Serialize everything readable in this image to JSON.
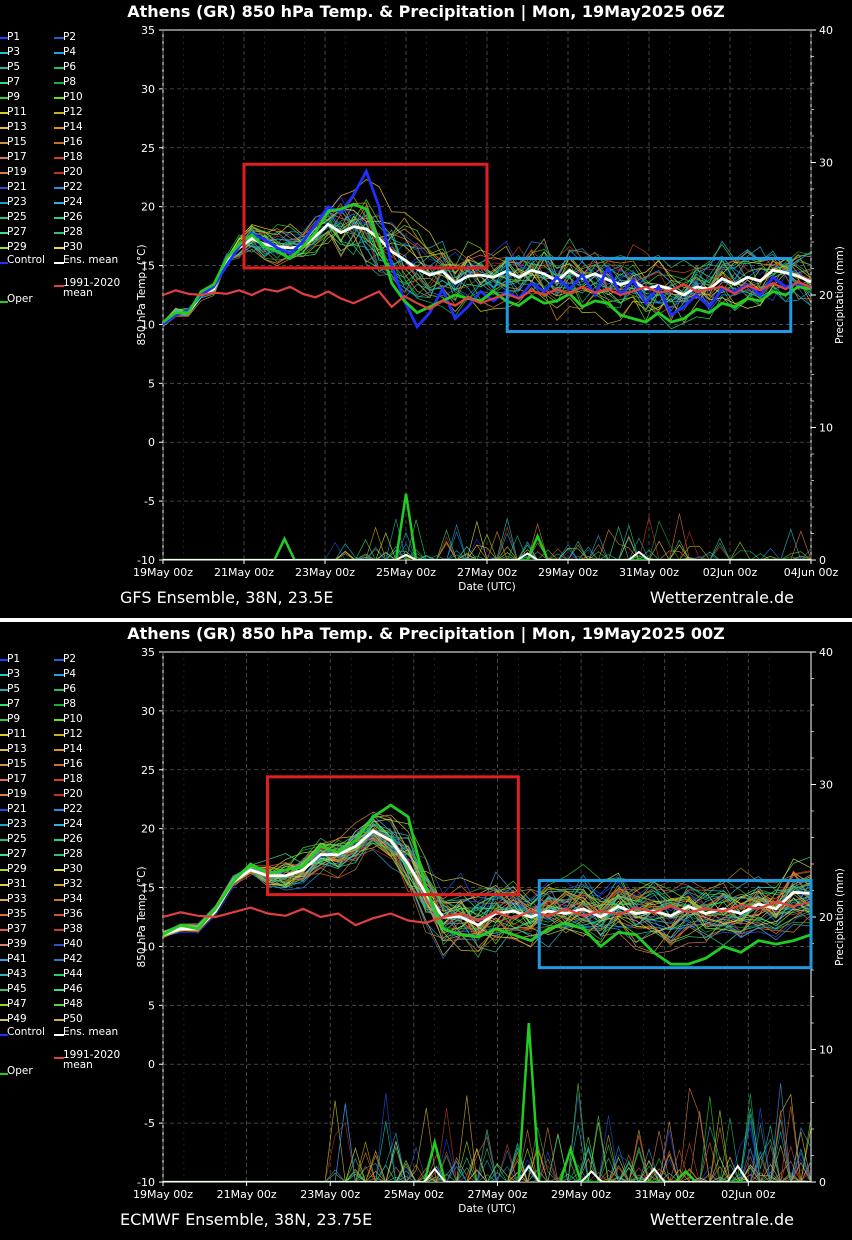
{
  "panels": [
    {
      "title": "Athens  (GR)  850 hPa Temp. & Precipitation | Mon, 19May2025 06Z",
      "model_label": "GFS Ensemble, 38N, 23.5E",
      "brand": "Wetterzentrale.de",
      "legend": {
        "members": [
          "P1",
          "P2",
          "P3",
          "P4",
          "P5",
          "P6",
          "P7",
          "P8",
          "P9",
          "P10",
          "P11",
          "P12",
          "P13",
          "P14",
          "P15",
          "P16",
          "P17",
          "P18",
          "P19",
          "P20",
          "P21",
          "P22",
          "P23",
          "P24",
          "P25",
          "P26",
          "P27",
          "P28",
          "P29",
          "P30"
        ],
        "control": "Control",
        "ens_mean": "Ens. mean",
        "oper": "Oper",
        "climate": "1991-2020\nmean"
      },
      "chart_data": {
        "type": "line",
        "ylabel": "850 hPa Temp. (°C)",
        "y2label": "Precipitation (mm)",
        "ylim": [
          -10,
          35
        ],
        "y2lim": [
          0,
          40
        ],
        "xlim": [
          "19May 00z",
          "04Jun 00z"
        ],
        "x_ticks": [
          "19May 00z",
          "21May 00z",
          "23May 00z",
          "25May 00z",
          "27May 00z",
          "29May 00z",
          "31May 00z",
          "02Jun 00z",
          "04Jun 00z"
        ],
        "y_ticks": [
          -10,
          -5,
          0,
          5,
          10,
          15,
          20,
          25,
          30,
          35
        ],
        "y2_ticks": [
          0,
          10,
          20,
          30,
          40
        ],
        "grid": true,
        "x_hours": [
          6,
          12,
          18,
          24,
          30,
          36,
          42,
          48,
          54,
          60,
          66,
          72,
          78,
          84,
          90,
          96,
          102,
          108,
          114,
          120,
          126,
          132,
          138,
          144,
          150,
          156,
          162,
          168,
          174,
          180,
          186,
          192,
          198,
          204,
          210,
          216,
          222,
          228,
          234,
          240,
          246,
          252,
          258,
          264,
          270,
          276,
          282,
          288,
          294,
          300,
          306,
          312,
          318,
          324,
          330,
          336,
          342,
          348,
          354,
          360,
          366,
          372,
          378,
          384
        ],
        "series": [
          {
            "name": "Ens. mean",
            "color": "#ffffff",
            "values": [
              10.0,
              11.0,
              11.0,
              12.5,
              13.0,
              15.5,
              16.5,
              17.3,
              16.8,
              16.6,
              16.5,
              16.6,
              17.5,
              18.5,
              17.8,
              18.3,
              18.1,
              17.3,
              16.2,
              15.5,
              14.7,
              14.2,
              14.5,
              13.5,
              14.1,
              14.2,
              14.0,
              14.5,
              14.0,
              14.6,
              14.3,
              13.7,
              14.6,
              13.9,
              14.3,
              13.8,
              13.4,
              13.7,
              13.0,
              13.3,
              13.0,
              12.5,
              13.2,
              13.0,
              13.9,
              13.4,
              14.0,
              13.7,
              14.6,
              14.4,
              14.1,
              13.6
            ]
          },
          {
            "name": "Control",
            "color": "#1f2fff",
            "values": [
              10.0,
              10.8,
              11.2,
              12.5,
              13.2,
              15.0,
              16.6,
              17.7,
              17.2,
              16.5,
              16.0,
              17.0,
              18.5,
              20.0,
              19.5,
              21.0,
              23.0,
              20.0,
              15.0,
              12.0,
              9.8,
              11.0,
              13.0,
              10.5,
              11.5,
              12.8,
              12.0,
              12.8,
              12.2,
              13.5,
              12.8,
              14.0,
              13.0,
              14.2,
              12.5,
              14.8,
              12.5,
              13.8,
              11.8,
              13.2,
              10.8,
              11.5,
              12.5,
              11.5,
              13.0,
              12.8,
              13.4,
              12.5,
              14.0,
              13.2,
              13.5,
              13.0
            ]
          },
          {
            "name": "Oper",
            "color": "#22cc22",
            "values": [
              10.2,
              11.0,
              11.0,
              12.8,
              13.4,
              15.6,
              16.8,
              17.6,
              16.6,
              16.2,
              15.6,
              16.6,
              17.8,
              19.6,
              19.8,
              20.2,
              19.8,
              17.0,
              13.5,
              12.0,
              11.0,
              11.5,
              12.0,
              12.5,
              12.2,
              12.0,
              12.8,
              12.0,
              11.6,
              12.4,
              11.8,
              12.0,
              12.6,
              11.5,
              12.0,
              11.8,
              10.8,
              10.5,
              10.2,
              11.0,
              10.2,
              10.5,
              11.3,
              11.0,
              11.8,
              11.5,
              12.2,
              12.0,
              12.8,
              12.5,
              13.2,
              13.0
            ]
          },
          {
            "name": "1991-2020 mean",
            "color": "#e04040",
            "values": [
              12.5,
              12.9,
              12.6,
              12.5,
              12.7,
              12.6,
              12.9,
              12.5,
              13.0,
              12.8,
              13.2,
              12.6,
              12.3,
              12.8,
              12.2,
              11.8,
              12.3,
              12.8,
              11.5,
              12.4,
              11.8,
              11.3,
              12.0,
              11.6,
              12.3,
              11.8,
              12.2,
              12.6,
              12.2,
              12.9,
              12.5,
              13.0,
              12.6,
              13.2,
              12.7,
              13.0,
              12.5,
              12.8,
              13.2,
              12.7,
              12.9,
              13.4,
              12.8,
              13.0,
              13.2,
              12.6,
              13.3,
              12.9,
              13.5,
              13.0,
              13.6,
              13.1
            ]
          }
        ],
        "precip_series": [
          {
            "name": "Oper",
            "color": "#22cc22",
            "values": [
              0,
              0,
              0,
              0,
              0,
              0,
              0,
              0,
              0,
              0,
              0,
              0,
              0,
              0,
              0,
              0,
              0,
              0,
              0,
              0,
              1.5,
              0,
              0,
              0,
              0,
              0,
              0,
              0,
              0,
              0,
              0,
              0,
              0,
              0,
              0,
              0,
              0,
              0,
              0,
              0,
              0,
              0,
              0,
              0,
              0,
              0,
              0,
              0,
              0,
              0,
              0,
              0,
              0,
              0,
              0,
              0,
              0,
              0,
              0,
              0,
              0,
              0,
              0,
              0,
              0
            ],
            "peaks": [
              [
                72,
                1.6
              ],
              [
                144,
                5.0
              ],
              [
                222,
                1.8
              ]
            ]
          },
          {
            "name": "Ens. mean",
            "color": "#ffffff",
            "values": [],
            "peaks": [
              [
                144,
                0.4
              ],
              [
                216,
                0.5
              ],
              [
                282,
                0.6
              ]
            ]
          }
        ]
      },
      "boxes": [
        {
          "name": "red",
          "color": "#e02020",
          "x_range": [
            "21May 00z",
            "27May 00z"
          ],
          "y_range": [
            14.8,
            23.6
          ]
        },
        {
          "name": "blue",
          "color": "#1e9be0",
          "x_range": [
            "27May 12z",
            "03Jun 12z"
          ],
          "y_range": [
            9.4,
            15.6
          ]
        }
      ]
    },
    {
      "title": "Athens  (GR)  850 hPa Temp. & Precipitation | Mon, 19May2025 00Z",
      "model_label": "ECMWF Ensemble, 38N, 23.75E",
      "brand": "Wetterzentrale.de",
      "legend": {
        "members": [
          "P1",
          "P2",
          "P3",
          "P4",
          "P5",
          "P6",
          "P7",
          "P8",
          "P9",
          "P10",
          "P11",
          "P12",
          "P13",
          "P14",
          "P15",
          "P16",
          "P17",
          "P18",
          "P19",
          "P20",
          "P21",
          "P22",
          "P23",
          "P24",
          "P25",
          "P26",
          "P27",
          "P28",
          "P29",
          "P30",
          "P31",
          "P32",
          "P33",
          "P34",
          "P35",
          "P36",
          "P37",
          "P38",
          "P39",
          "P40",
          "P41",
          "P42",
          "P43",
          "P44",
          "P45",
          "P46",
          "P47",
          "P48",
          "P49",
          "P50"
        ],
        "control": "Control",
        "ens_mean": "Ens. mean",
        "oper": "Oper",
        "climate": "1991-2020\nmean"
      },
      "chart_data": {
        "type": "line",
        "ylabel": "850 hPa Temp. (°C)",
        "y2label": "Precipitation (mm)",
        "ylim": [
          -10,
          35
        ],
        "y2lim": [
          0,
          40
        ],
        "xlim": [
          "19May 00z",
          "03Jun 12z"
        ],
        "x_ticks": [
          "19May 00z",
          "21May 00z",
          "23May 00z",
          "25May 00z",
          "27May 00z",
          "29May 00z",
          "31May 00z",
          "02Jun 00z"
        ],
        "y_ticks": [
          -10,
          -5,
          0,
          5,
          10,
          15,
          20,
          25,
          30,
          35
        ],
        "y2_ticks": [
          0,
          10,
          20,
          30,
          40
        ],
        "grid": true,
        "series": [
          {
            "name": "Ens. mean",
            "color": "#ffffff",
            "values": [
              11.0,
              11.5,
              11.5,
              13.0,
              15.5,
              16.5,
              16.0,
              16.0,
              16.5,
              17.8,
              17.8,
              18.5,
              19.8,
              19.0,
              17.0,
              14.5,
              12.5,
              12.5,
              11.8,
              12.8,
              13.0,
              12.5,
              13.0,
              12.8,
              13.2,
              12.5,
              13.4,
              12.8,
              13.0,
              12.6,
              13.4,
              12.8,
              13.2,
              12.8,
              13.6,
              13.2,
              14.6,
              14.5
            ]
          },
          {
            "name": "Oper",
            "color": "#22cc22",
            "values": [
              11.0,
              11.8,
              11.5,
              13.2,
              15.5,
              17.0,
              16.2,
              16.5,
              16.8,
              18.5,
              18.0,
              19.0,
              21.0,
              22.0,
              21.0,
              15.0,
              11.5,
              11.0,
              10.8,
              11.5,
              11.0,
              10.5,
              11.5,
              12.0,
              11.5,
              10.0,
              11.2,
              11.0,
              9.5,
              8.5,
              8.5,
              9.0,
              10.0,
              9.5,
              10.5,
              10.2,
              10.5,
              11.0
            ]
          },
          {
            "name": "1991-2020 mean",
            "color": "#e04040",
            "values": [
              12.5,
              12.9,
              12.6,
              12.5,
              12.9,
              13.3,
              12.8,
              12.6,
              13.2,
              12.5,
              12.8,
              11.8,
              12.4,
              12.8,
              12.2,
              12.0,
              12.5,
              12.8,
              12.2,
              12.9,
              12.4,
              13.0,
              12.6,
              13.2,
              12.6,
              13.0,
              12.7,
              13.3,
              12.9,
              13.4,
              12.9,
              13.2,
              13.0,
              13.5,
              13.2,
              13.8,
              13.4,
              13.8
            ]
          }
        ],
        "precip_series": [
          {
            "name": "Oper",
            "color": "#22cc22",
            "values": [],
            "peaks": [
              [
                156,
                3.0
              ],
              [
                210,
                12.0
              ],
              [
                234,
                2.5
              ],
              [
                300,
                0.8
              ]
            ]
          },
          {
            "name": "Ens. mean",
            "color": "#ffffff",
            "values": [],
            "peaks": [
              [
                156,
                1.0
              ],
              [
                210,
                1.2
              ],
              [
                246,
                0.8
              ],
              [
                282,
                1.0
              ],
              [
                330,
                1.2
              ]
            ]
          }
        ]
      },
      "boxes": [
        {
          "name": "red",
          "color": "#e02020",
          "x_range": [
            "21May 12z",
            "27May 12z"
          ],
          "y_range": [
            14.4,
            24.4
          ]
        },
        {
          "name": "blue",
          "color": "#1e9be0",
          "x_range": [
            "28May 00z",
            "03Jun 12z"
          ],
          "y_range": [
            8.2,
            15.6
          ]
        }
      ]
    }
  ]
}
